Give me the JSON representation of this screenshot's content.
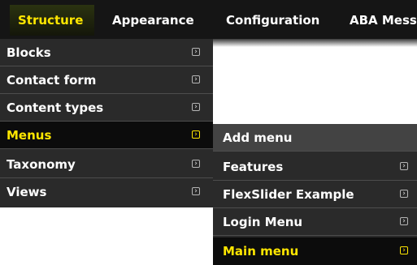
{
  "nav": {
    "tabs": [
      {
        "label": "Structure",
        "active": true
      },
      {
        "label": "Appearance"
      },
      {
        "label": "Configuration"
      },
      {
        "label": "ABA Mess"
      }
    ]
  },
  "structure_menu": {
    "items": [
      {
        "label": "Blocks"
      },
      {
        "label": "Contact form"
      },
      {
        "label": "Content types"
      },
      {
        "label": "Menus",
        "active": true
      },
      {
        "label": "Taxonomy"
      },
      {
        "label": "Views"
      }
    ]
  },
  "menus_submenu": {
    "items": [
      {
        "label": "Add menu"
      },
      {
        "label": "Features"
      },
      {
        "label": "FlexSlider Example"
      },
      {
        "label": "Login Menu"
      },
      {
        "label": "Main menu",
        "active": true
      }
    ]
  },
  "icons": {
    "submenu_arrow": "arrow-right-square-icon"
  },
  "colors": {
    "active_text": "#ffe600",
    "menu_bg": "#2a2a2a",
    "topbar_bg": "#151515"
  }
}
